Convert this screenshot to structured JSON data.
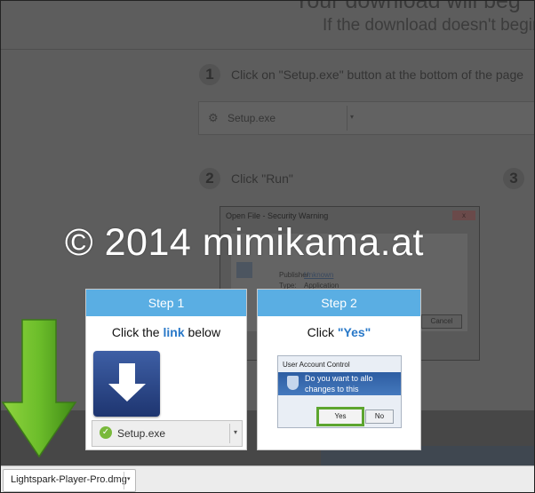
{
  "background_page": {
    "headline": "Your download will beg",
    "subline": "If the download doesn't begin au",
    "step1": {
      "number": "1",
      "text": "Click on \"Setup.exe\" button at the bottom of the page"
    },
    "download_bar": {
      "filename": "Setup.exe",
      "caret": "▾"
    },
    "step2": {
      "number": "2",
      "text": "Click \"Run\""
    },
    "step3": {
      "number": "3"
    },
    "dialog": {
      "title": "Open File - Security Warning",
      "publisher_label": "Publisher:",
      "publisher_value": "Unknown",
      "type_label": "Type:",
      "type_value": "Application",
      "cancel_label": "Cancel",
      "close_label": "x"
    }
  },
  "watermark": "© 2014 mimikama.at",
  "cards": {
    "step1": {
      "header": "Step 1",
      "text_before": "Click the ",
      "text_link": "link",
      "text_after": " below",
      "download_name": "Setup.exe",
      "caret": "▾"
    },
    "step2": {
      "header": "Step 2",
      "text_before": "Click ",
      "text_quote": "\"Yes\"",
      "uac_title": "User Account Control",
      "uac_message_line1": "Do you want to allo",
      "uac_message_line2": "changes to this",
      "yes_label": "Yes",
      "no_label": "No"
    }
  },
  "download_shelf": {
    "filename": "Lightspark-Player-Pro.dmg",
    "caret": "▾"
  },
  "colors": {
    "card_header": "#5aaee3",
    "link_blue": "#2878c8",
    "arrow_green": "#6cbd2a",
    "yes_highlight": "#5ca52f"
  },
  "icons": {
    "arrow": "green-down-arrow-icon",
    "download": "download-arrow-icon",
    "check": "check-circle-icon",
    "shield": "uac-shield-icon"
  }
}
